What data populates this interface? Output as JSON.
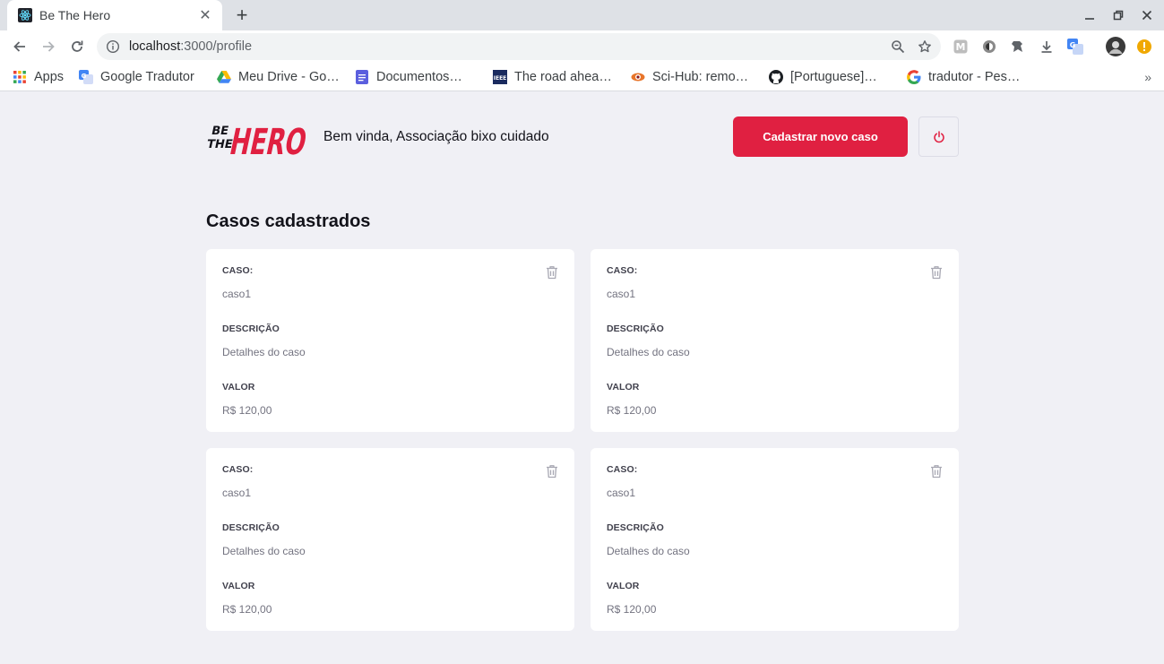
{
  "browser": {
    "tab_title": "Be The Hero",
    "url_host": "localhost",
    "url_rest": ":3000/profile",
    "bookmarks": [
      {
        "label": "Apps",
        "icon": "apps-grid-icon"
      },
      {
        "label": "Google Tradutor",
        "icon": "google-translate-icon"
      },
      {
        "label": "Meu Drive - Go…",
        "icon": "google-drive-icon"
      },
      {
        "label": "Documentos…",
        "icon": "google-docs-icon"
      },
      {
        "label": "The road ahea…",
        "icon": "ieee-icon"
      },
      {
        "label": "Sci-Hub: remo…",
        "icon": "scihub-icon"
      },
      {
        "label": "[Portuguese]…",
        "icon": "github-icon"
      },
      {
        "label": "tradutor - Pes…",
        "icon": "google-icon"
      }
    ]
  },
  "header": {
    "logo_line1": "BE",
    "logo_line2": "THE",
    "logo_word": "HERO",
    "welcome": "Bem vinda, Associação bixo cuidado",
    "new_case_label": "Cadastrar novo caso"
  },
  "main": {
    "title": "Casos cadastrados",
    "cases": [
      {
        "case_label": "CASO:",
        "case_value": "caso1",
        "desc_label": "DESCRIÇÃO",
        "desc_value": "Detalhes do caso",
        "value_label": "VALOR",
        "value": "R$ 120,00"
      },
      {
        "case_label": "CASO:",
        "case_value": "caso1",
        "desc_label": "DESCRIÇÃO",
        "desc_value": "Detalhes do caso",
        "value_label": "VALOR",
        "value": "R$ 120,00"
      },
      {
        "case_label": "CASO:",
        "case_value": "caso1",
        "desc_label": "DESCRIÇÃO",
        "desc_value": "Detalhes do caso",
        "value_label": "VALOR",
        "value": "R$ 120,00"
      },
      {
        "case_label": "CASO:",
        "case_value": "caso1",
        "desc_label": "DESCRIÇÃO",
        "desc_value": "Detalhes do caso",
        "value_label": "VALOR",
        "value": "R$ 120,00"
      }
    ]
  },
  "colors": {
    "brand_red": "#e02041",
    "page_bg": "#f0f0f5",
    "text_dark": "#13131a",
    "text_muted": "#737380"
  }
}
